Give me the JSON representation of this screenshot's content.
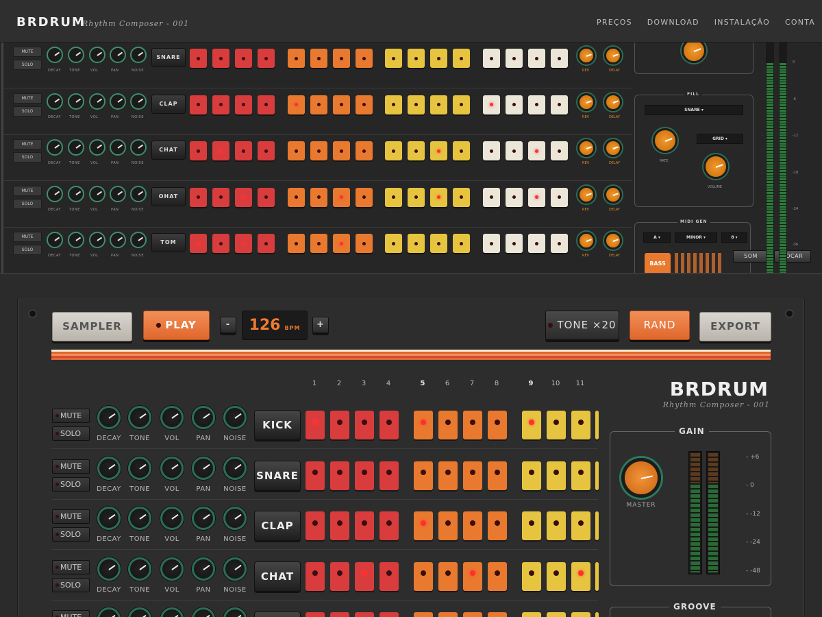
{
  "header": {
    "logo": "BRDRUM",
    "subtitle": "Rhythm Composer - 001",
    "nav": [
      "PREÇOS",
      "DOWNLOAD",
      "INSTALAÇÃO",
      "CONTA"
    ]
  },
  "preview": {
    "mute": "MUTE",
    "solo": "SOLO",
    "knob_labels": [
      "DECAY",
      "TONE",
      "VOL",
      "PAN",
      "NOISE"
    ],
    "fx_labels": [
      "REV",
      "DELAY"
    ],
    "rows": [
      {
        "name": "SNARE",
        "steps": [
          0,
          0,
          0,
          0,
          0,
          0,
          0,
          0,
          0,
          0,
          0,
          0,
          0,
          0,
          0,
          0
        ]
      },
      {
        "name": "CLAP",
        "steps": [
          0,
          0,
          0,
          0,
          1,
          0,
          0,
          0,
          0,
          0,
          0,
          0,
          1,
          0,
          0,
          0
        ]
      },
      {
        "name": "CHAT",
        "steps": [
          0,
          1,
          0,
          0,
          0,
          0,
          0,
          0,
          0,
          0,
          1,
          0,
          0,
          0,
          1,
          0
        ]
      },
      {
        "name": "OHAT",
        "steps": [
          0,
          0,
          1,
          0,
          0,
          0,
          1,
          0,
          0,
          0,
          1,
          0,
          0,
          0,
          1,
          0
        ]
      },
      {
        "name": "TOM",
        "steps": [
          1,
          0,
          1,
          0,
          0,
          0,
          1,
          0,
          0,
          0,
          0,
          0,
          0,
          0,
          0,
          0
        ]
      }
    ],
    "fill": {
      "title": "FILL",
      "instrument": "SNARE",
      "rate": "RATE",
      "mode": "GRID",
      "volume": "VOLUME"
    },
    "midi": {
      "title": "MIDI GEN",
      "key": "A",
      "scale": "MINOR",
      "octave": "8",
      "bass": "BASS"
    },
    "meter_scale": [
      "0",
      "-6",
      "-12",
      "-18",
      "-24",
      "-36"
    ],
    "buttons": {
      "som": "SOM",
      "tocar": "TOCAR"
    }
  },
  "transport": {
    "sampler": "SAMPLER",
    "play": "PLAY",
    "minus": "-",
    "plus": "+",
    "bpm_value": "126",
    "bpm_unit": "BPM",
    "tone": "TONE ×20",
    "rand": "RAND",
    "export": "EXPORT"
  },
  "colors": {
    "stripe": [
      "#f3ead0",
      "#e0672c",
      "#f29057",
      "#d44a3a",
      "#e0672c"
    ],
    "group1": "#d83c3c",
    "group2": "#e9792e",
    "group3": "#e7c43f",
    "group4": "#ebe6d8"
  },
  "steps": {
    "numbers": [
      "1",
      "2",
      "3",
      "4",
      "5",
      "6",
      "7",
      "8",
      "9",
      "10",
      "11"
    ],
    "bold": [
      4,
      8
    ]
  },
  "tracks": [
    {
      "name": "KICK",
      "steps": [
        1,
        0,
        0,
        0,
        1,
        0,
        0,
        0,
        1,
        0,
        0
      ]
    },
    {
      "name": "SNARE",
      "steps": [
        0,
        0,
        0,
        0,
        0,
        0,
        0,
        0,
        0,
        0,
        0
      ]
    },
    {
      "name": "CLAP",
      "steps": [
        0,
        0,
        0,
        0,
        1,
        0,
        0,
        0,
        0,
        0,
        0
      ]
    },
    {
      "name": "CHAT",
      "steps": [
        0,
        0,
        1,
        0,
        0,
        0,
        1,
        0,
        0,
        0,
        1
      ]
    },
    {
      "name": "",
      "steps": [
        0,
        0,
        0,
        0,
        0,
        0,
        0,
        0,
        0,
        0,
        0
      ]
    }
  ],
  "brand": {
    "name": "BRDRUM",
    "sub": "Rhythm Composer - 001"
  },
  "gain": {
    "title": "GAIN",
    "master": "MASTER",
    "scale": [
      "- +6",
      "- 0",
      "- -12",
      "- -24",
      "- -48"
    ]
  },
  "groove": {
    "title": "GROOVE"
  }
}
